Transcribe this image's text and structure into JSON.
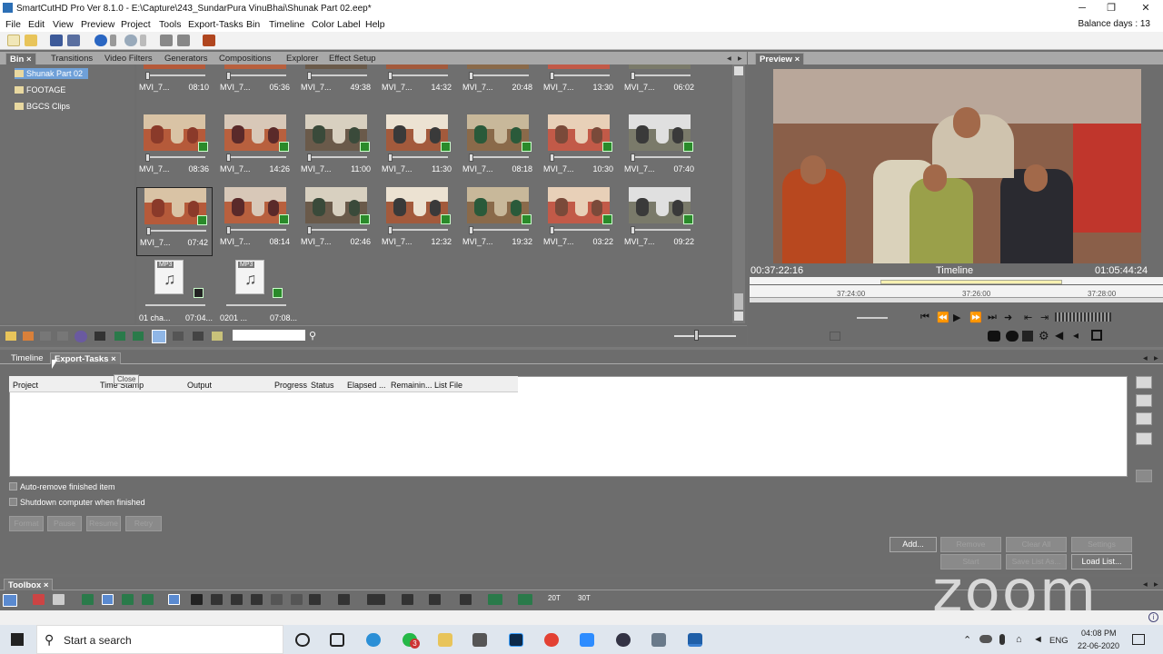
{
  "window": {
    "title": "SmartCutHD Pro Ver 8.1.0 - E:\\Capture\\243_SundarPura VinuBhai\\Shunak Part 02.eep*",
    "minimize": "─",
    "restore": "❐",
    "close": "✕"
  },
  "menu": [
    "File",
    "Edit",
    "View",
    "Preview",
    "Project",
    "Tools",
    "Export-Tasks",
    "Bin",
    "Timeline",
    "Color Label",
    "Help"
  ],
  "balance": "Balance days : 13",
  "bin_tabs": [
    "Bin",
    "Transitions",
    "Video Filters",
    "Generators",
    "Compositions",
    "Explorer",
    "Effect Setup"
  ],
  "tree": [
    "Shunak Part 02",
    "FOOTAGE",
    "BGCS Clips"
  ],
  "clips": [
    {
      "name": "MVI_7...",
      "dur": "08:10"
    },
    {
      "name": "MVI_7...",
      "dur": "05:36"
    },
    {
      "name": "MVI_7...",
      "dur": "49:38"
    },
    {
      "name": "MVI_7...",
      "dur": "14:32"
    },
    {
      "name": "MVI_7...",
      "dur": "20:48"
    },
    {
      "name": "MVI_7...",
      "dur": "13:30"
    },
    {
      "name": "MVI_7...",
      "dur": "06:02"
    },
    {
      "name": "MVI_7...",
      "dur": "08:36"
    },
    {
      "name": "MVI_7...",
      "dur": "14:26"
    },
    {
      "name": "MVI_7...",
      "dur": "11:00"
    },
    {
      "name": "MVI_7...",
      "dur": "11:30"
    },
    {
      "name": "MVI_7...",
      "dur": "08:18"
    },
    {
      "name": "MVI_7...",
      "dur": "10:30"
    },
    {
      "name": "MVI_7...",
      "dur": "07:40"
    },
    {
      "name": "MVI_7...",
      "dur": "07:42"
    },
    {
      "name": "MVI_7...",
      "dur": "08:14"
    },
    {
      "name": "MVI_7...",
      "dur": "02:46"
    },
    {
      "name": "MVI_7...",
      "dur": "12:32"
    },
    {
      "name": "MVI_7...",
      "dur": "19:32"
    },
    {
      "name": "MVI_7...",
      "dur": "03:22"
    },
    {
      "name": "MVI_7...",
      "dur": "09:22"
    }
  ],
  "audio": [
    {
      "name": "01 cha...",
      "dur": "07:04...",
      "tag": "MP3"
    },
    {
      "name": "0201 ...",
      "dur": "07:08...",
      "tag": "MP3"
    }
  ],
  "preview": {
    "tab": "Preview",
    "left_tc": "00:37:22:16",
    "label": "Timeline",
    "right_tc": "01:05:44:24",
    "ticks": [
      "37:24:00",
      "37:26:00",
      "37:28:00"
    ]
  },
  "lower_tabs": [
    "Timeline",
    "Export-Tasks"
  ],
  "tooltip": "Close",
  "columns": [
    "Project",
    "Time Stamp",
    "Output",
    "Progress",
    "Status",
    "Elapsed ...",
    "Remainin...",
    "List File"
  ],
  "options": [
    "Auto-remove finished item",
    "Shutdown computer when finished"
  ],
  "format_buttons": [
    "Format",
    "Pause",
    "Resume",
    "Retry"
  ],
  "right_buttons": {
    "add": "Add...",
    "remove": "Remove",
    "clear_all": "Clear All",
    "settings": "Settings",
    "start": "Start",
    "save_list": "Save List As...",
    "load_list": "Load List..."
  },
  "toolbox_tab": "Toolbox",
  "toolbox_labels": [
    "20T",
    "30T"
  ],
  "watermark": "zoom",
  "taskbar": {
    "search": "Start a search",
    "lang": "ENG",
    "time": "04:08 PM",
    "date": "22-06-2020",
    "badge": "3"
  }
}
